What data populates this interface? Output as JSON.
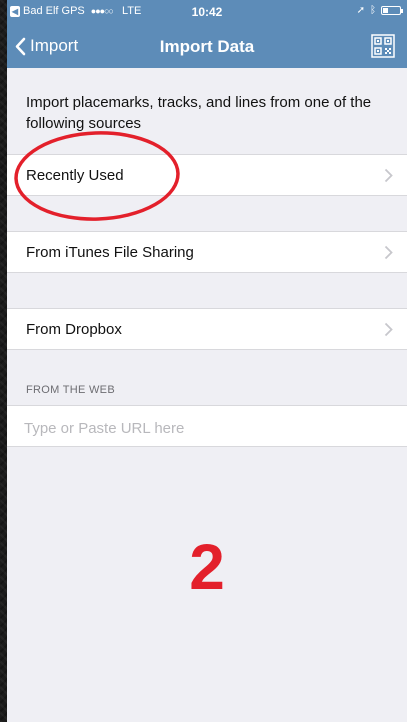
{
  "status_bar": {
    "carrier": "Bad Elf GPS",
    "signal": "●●●○○",
    "network": "LTE",
    "time": "10:42",
    "battery_level": 0.3
  },
  "nav": {
    "back_label": "Import",
    "title": "Import Data",
    "qr_icon": "qr-code-icon"
  },
  "intro_text": "Import placemarks, tracks, and lines from one of the following sources",
  "sources": [
    {
      "label": "Recently Used"
    },
    {
      "label": "From iTunes File Sharing"
    },
    {
      "label": "From Dropbox"
    }
  ],
  "web_section": {
    "header": "FROM THE WEB",
    "url_value": "",
    "url_placeholder": "Type or Paste URL here"
  },
  "annotation": {
    "number": "2",
    "color": "#e3202b"
  },
  "colors": {
    "nav_bar": "#5d8cb8",
    "background": "#efeff4"
  }
}
